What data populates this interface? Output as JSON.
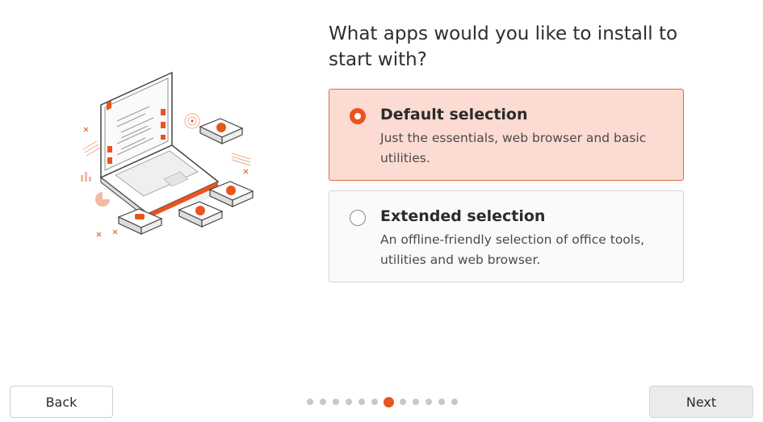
{
  "page": {
    "title": "What apps would you like to install to start with?"
  },
  "options": [
    {
      "title": "Default selection",
      "description": "Just the essentials, web browser and basic utilities.",
      "selected": true
    },
    {
      "title": "Extended selection",
      "description": "An offline-friendly selection of office tools, utilities and web browser.",
      "selected": false
    }
  ],
  "buttons": {
    "back_label": "Back",
    "next_label": "Next"
  },
  "progress": {
    "total_steps": 12,
    "current_step": 7
  },
  "colors": {
    "accent": "#e95420",
    "selected_bg": "#fbdbd2",
    "selected_border": "#e06a43"
  },
  "illustration": {
    "icon": "laptop-with-apps-illustration"
  }
}
